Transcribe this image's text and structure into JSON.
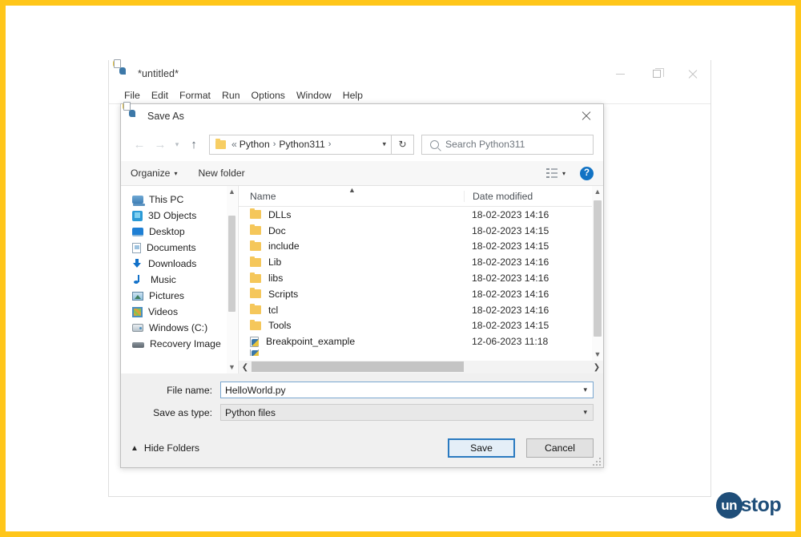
{
  "idle_window": {
    "title": "*untitled*",
    "icon": "python-idle-icon",
    "menus": [
      "File",
      "Edit",
      "Format",
      "Run",
      "Options",
      "Window",
      "Help"
    ],
    "controls": {
      "minimize": "minimize-icon",
      "maximize": "restore-icon",
      "close": "close-icon"
    }
  },
  "dialog": {
    "title": "Save As",
    "icon": "python-idle-icon",
    "close_label": "close-icon",
    "nav": {
      "back": "back-arrow-icon",
      "forward": "forward-arrow-icon",
      "recent": "chevron-down-icon",
      "up": "up-arrow-icon"
    },
    "address": {
      "folder_icon": "folder-icon",
      "prefix": "«",
      "crumbs": [
        "Python",
        "Python311"
      ],
      "separator": "›",
      "dropdown": "chevron-down-icon"
    },
    "refresh_label": "↻",
    "search": {
      "icon": "search-icon",
      "placeholder": "Search Python311"
    },
    "toolbar": {
      "organize": "Organize",
      "new_folder": "New folder",
      "view_icon": "view-layout-icon",
      "view_dropdown": "chevron-down-icon",
      "help": "?"
    },
    "sidebar": [
      {
        "label": "This PC",
        "icon": "this-pc-icon",
        "cls": "ic-pc"
      },
      {
        "label": "3D Objects",
        "icon": "3d-objects-icon",
        "cls": "ic-3d"
      },
      {
        "label": "Desktop",
        "icon": "desktop-icon",
        "cls": "ic-desk"
      },
      {
        "label": "Documents",
        "icon": "documents-icon",
        "cls": "ic-doc"
      },
      {
        "label": "Downloads",
        "icon": "downloads-icon",
        "cls": "ic-dl"
      },
      {
        "label": "Music",
        "icon": "music-icon",
        "cls": "ic-mus"
      },
      {
        "label": "Pictures",
        "icon": "pictures-icon",
        "cls": "ic-pic"
      },
      {
        "label": "Videos",
        "icon": "videos-icon",
        "cls": "ic-vid"
      },
      {
        "label": "Windows (C:)",
        "icon": "drive-icon",
        "cls": "ic-drv"
      },
      {
        "label": "Recovery Image",
        "icon": "drive-icon",
        "cls": "ic-rec"
      }
    ],
    "columns": [
      "Name",
      "Date modified"
    ],
    "files": [
      {
        "name": "DLLs",
        "date": "18-02-2023 14:16",
        "type": "folder"
      },
      {
        "name": "Doc",
        "date": "18-02-2023 14:15",
        "type": "folder"
      },
      {
        "name": "include",
        "date": "18-02-2023 14:15",
        "type": "folder"
      },
      {
        "name": "Lib",
        "date": "18-02-2023 14:16",
        "type": "folder"
      },
      {
        "name": "libs",
        "date": "18-02-2023 14:16",
        "type": "folder"
      },
      {
        "name": "Scripts",
        "date": "18-02-2023 14:16",
        "type": "folder"
      },
      {
        "name": "tcl",
        "date": "18-02-2023 14:16",
        "type": "folder"
      },
      {
        "name": "Tools",
        "date": "18-02-2023 14:15",
        "type": "folder"
      },
      {
        "name": "Breakpoint_example",
        "date": "12-06-2023 11:18",
        "type": "py"
      }
    ],
    "form": {
      "filename_label": "File name:",
      "filename_value": "HelloWorld.py",
      "savetype_label": "Save as type:",
      "savetype_value": "Python files"
    },
    "footer": {
      "hide_folders": "Hide Folders",
      "save": "Save",
      "cancel": "Cancel"
    }
  },
  "watermark": {
    "circle_text": "un",
    "word_text": "stop"
  },
  "colors": {
    "frame_border": "#FFC61A",
    "accent_blue": "#1273C4",
    "logo_navy": "#1F4E79",
    "folder_yellow": "#F5C75B"
  }
}
